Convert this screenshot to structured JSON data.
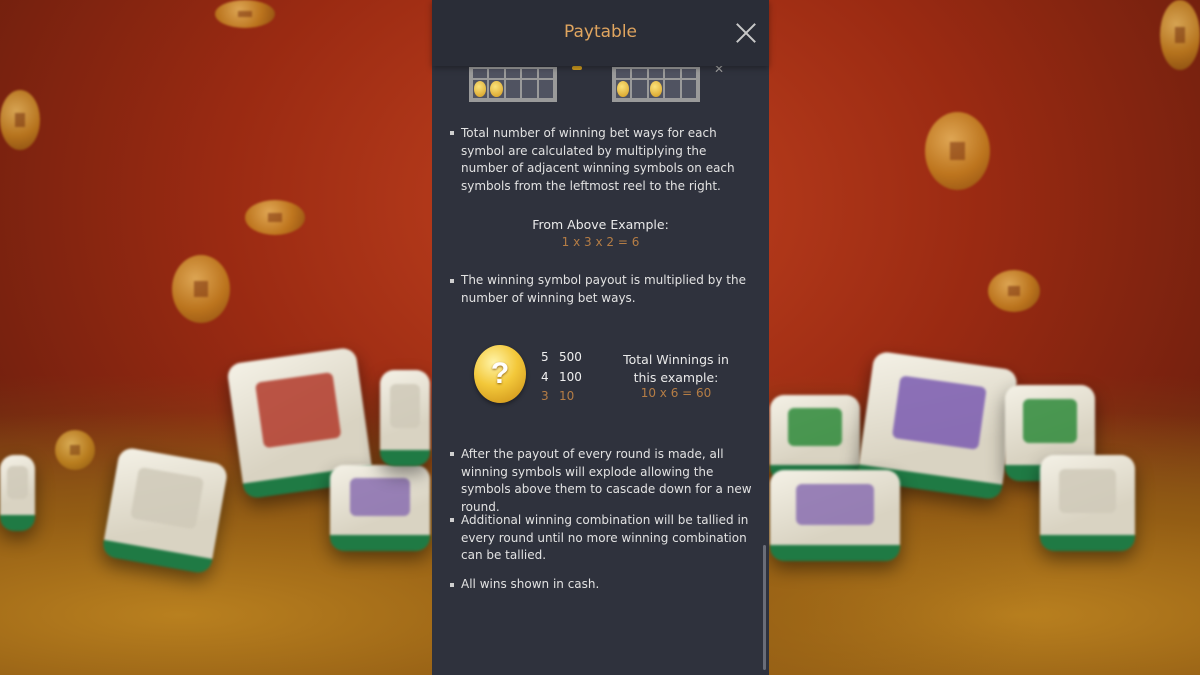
{
  "header": {
    "title": "Paytable"
  },
  "sections": {
    "ways_text": "Total number of winning bet ways for each symbol are calculated by multiplying the number of adjacent winning symbols on each symbols from the leftmost reel to the right.",
    "example_title": "From Above Example:",
    "example_formula": "1 x 3 x 2 = 6",
    "multiply_text": "The winning symbol payout is multiplied by the number of winning bet ways.",
    "symbol_icon": "question-coin-icon",
    "symbol_glyph": "?",
    "payouts": [
      {
        "count": "5",
        "amount": "500"
      },
      {
        "count": "4",
        "amount": "100"
      },
      {
        "count": "3",
        "amount": "10"
      }
    ],
    "total_title": "Total Winnings in this example:",
    "total_formula": "10 x 6 = 60",
    "cascade_text": "After the payout of every round is made, all winning symbols will explode allowing the symbols above them to cascade down for a new round.",
    "additional_text": "Additional winning combination will be tallied in every round until no more winning combination can be tallied.",
    "cash_text": "All wins shown in cash."
  },
  "colors": {
    "accent": "#e0a55f",
    "muted_orange": "#b57d45",
    "panel": "#2f323d"
  }
}
